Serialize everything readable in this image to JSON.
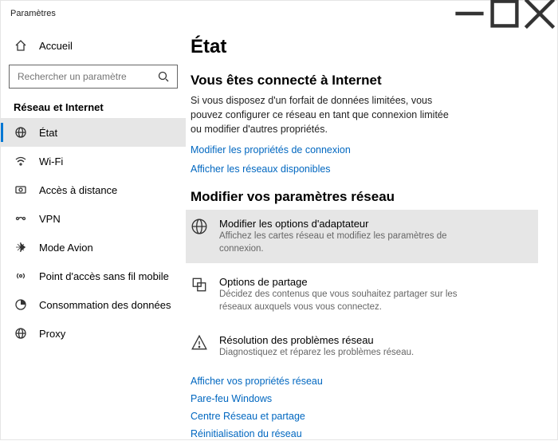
{
  "window": {
    "title": "Paramètres"
  },
  "sidebar": {
    "home_label": "Accueil",
    "search_placeholder": "Rechercher un paramètre",
    "category": "Réseau et Internet",
    "items": [
      {
        "label": "État"
      },
      {
        "label": "Wi-Fi"
      },
      {
        "label": "Accès à distance"
      },
      {
        "label": "VPN"
      },
      {
        "label": "Mode Avion"
      },
      {
        "label": "Point d'accès sans fil mobile"
      },
      {
        "label": "Consommation des données"
      },
      {
        "label": "Proxy"
      }
    ]
  },
  "page": {
    "title": "État",
    "status_title": "Vous êtes connecté à Internet",
    "status_body": "Si vous disposez d'un forfait de données limitées, vous pouvez configurer ce réseau en tant que connexion limitée ou modifier d'autres propriétés.",
    "link_connection_props": "Modifier les propriétés de connexion",
    "link_available_nets": "Afficher les réseaux disponibles",
    "modify_section": "Modifier vos paramètres réseau",
    "options": [
      {
        "title": "Modifier les options d'adaptateur",
        "desc": "Affichez les cartes réseau et modifiez les paramètres de connexion."
      },
      {
        "title": "Options de partage",
        "desc": "Décidez des contenus que vous souhaitez partager sur les réseaux auxquels vous vous connectez."
      },
      {
        "title": "Résolution des problèmes réseau",
        "desc": "Diagnostiquez et réparez les problèmes réseau."
      }
    ],
    "bottom_links": [
      "Afficher vos propriétés réseau",
      "Pare-feu Windows",
      "Centre Réseau et partage",
      "Réinitialisation du réseau"
    ]
  }
}
